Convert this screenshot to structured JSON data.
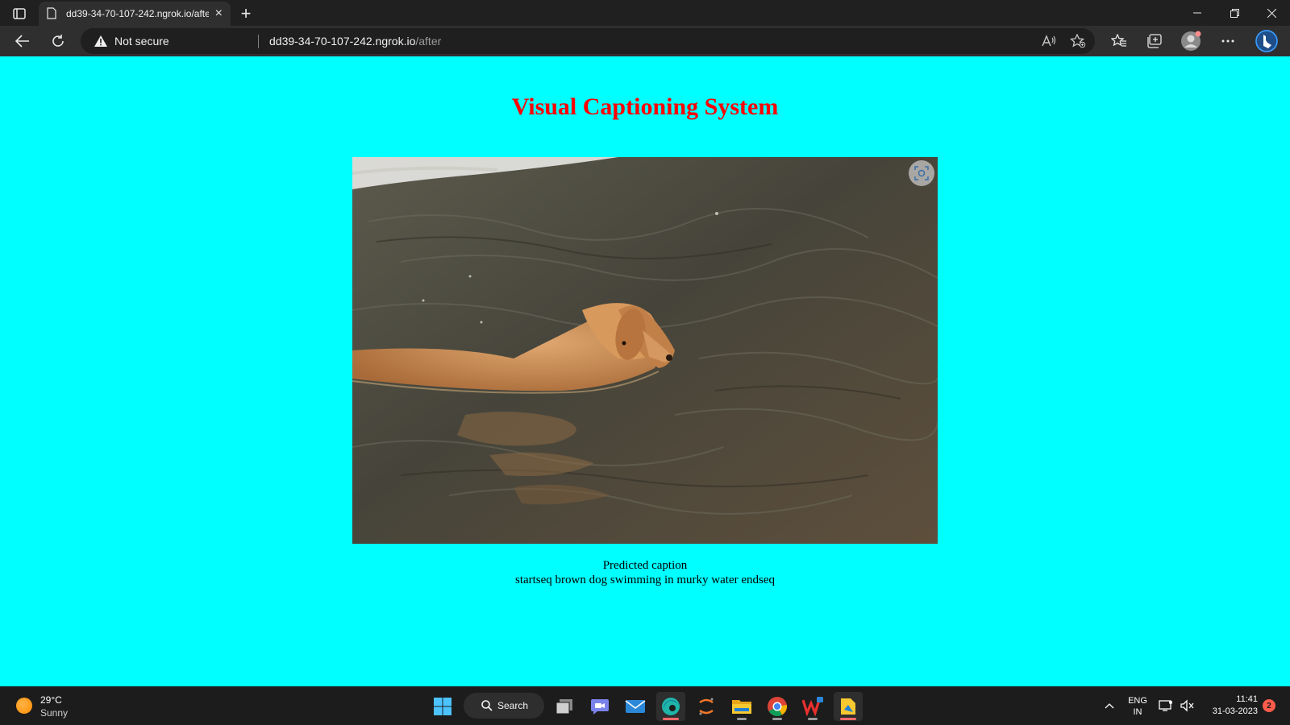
{
  "browser": {
    "tab_title": "dd39-34-70-107-242.ngrok.io/after",
    "new_tab_label": "+",
    "security_label": "Not secure",
    "url_host": "dd39-34-70-107-242.ngrok.io",
    "url_path": "/after"
  },
  "page": {
    "title": "Visual Captioning System",
    "caption_label": "Predicted caption",
    "caption_text": "startseq brown dog swimming in murky water endseq"
  },
  "taskbar": {
    "weather_temp": "29°C",
    "weather_condition": "Sunny",
    "search_label": "Search",
    "lang_line1": "ENG",
    "lang_line2": "IN",
    "time": "11:41",
    "date": "31-03-2023",
    "notification_count": "2"
  },
  "colors": {
    "page_background": "#00ffff",
    "title": "#ff0000"
  }
}
